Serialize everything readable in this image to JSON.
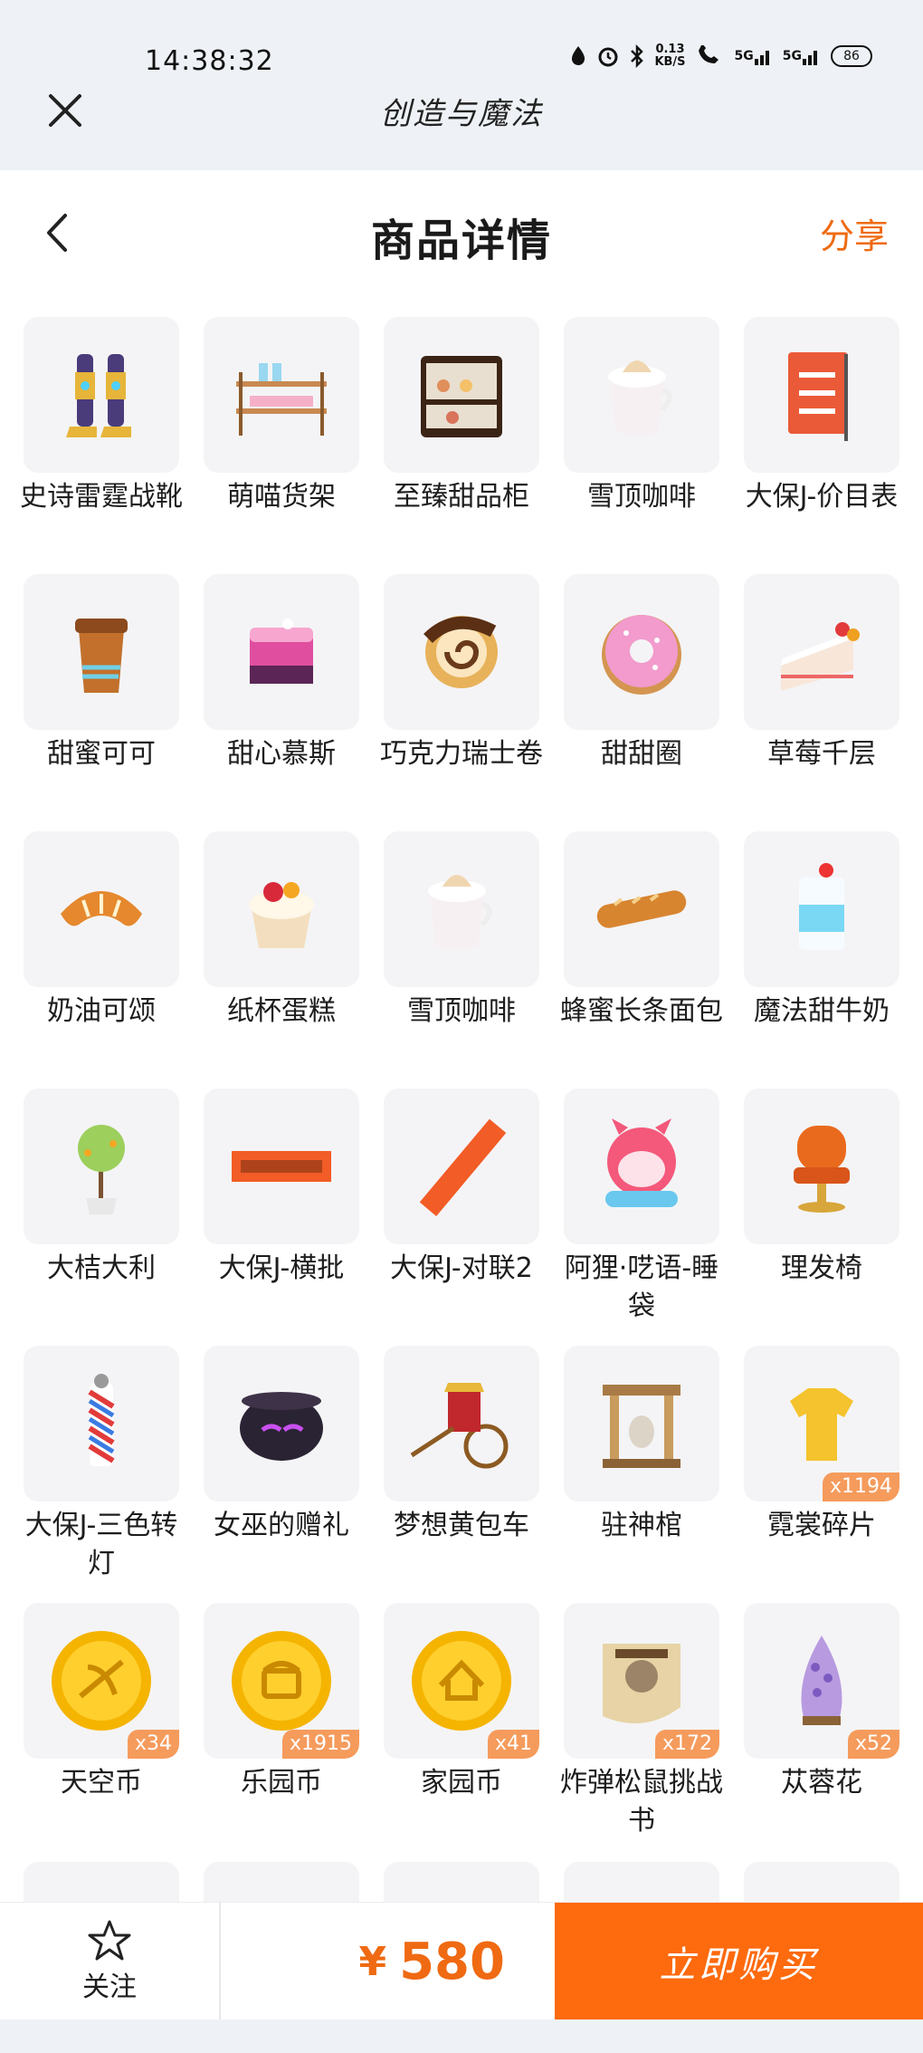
{
  "status": {
    "time": "14:38:32",
    "speed_top": "0.13",
    "speed_unit": "KB/S",
    "sig1": "5G",
    "sig2": "5G",
    "battery": "86"
  },
  "app": {
    "title": "创造与魔法"
  },
  "header": {
    "title": "商品详情",
    "share": "分享"
  },
  "items": [
    {
      "name": "史诗雷霆战靴",
      "icon": "boots-icon",
      "qty": ""
    },
    {
      "name": "萌喵货架",
      "icon": "shelf-icon",
      "qty": ""
    },
    {
      "name": "至臻甜品柜",
      "icon": "dessert-cabinet-icon",
      "qty": ""
    },
    {
      "name": "雪顶咖啡",
      "icon": "coffee-icon",
      "qty": ""
    },
    {
      "name": "大保J-价目表",
      "icon": "price-board-icon",
      "qty": ""
    },
    {
      "name": "甜蜜可可",
      "icon": "cocoa-cup-icon",
      "qty": ""
    },
    {
      "name": "甜心慕斯",
      "icon": "mousse-icon",
      "qty": ""
    },
    {
      "name": "巧克力瑞士卷",
      "icon": "swiss-roll-icon",
      "qty": ""
    },
    {
      "name": "甜甜圈",
      "icon": "donut-icon",
      "qty": ""
    },
    {
      "name": "草莓千层",
      "icon": "cake-slice-icon",
      "qty": ""
    },
    {
      "name": "奶油可颂",
      "icon": "croissant-icon",
      "qty": ""
    },
    {
      "name": "纸杯蛋糕",
      "icon": "cupcake-icon",
      "qty": ""
    },
    {
      "name": "雪顶咖啡",
      "icon": "coffee-icon",
      "qty": ""
    },
    {
      "name": "蜂蜜长条面包",
      "icon": "baguette-icon",
      "qty": ""
    },
    {
      "name": "魔法甜牛奶",
      "icon": "milk-icon",
      "qty": ""
    },
    {
      "name": "大桔大利",
      "icon": "tree-icon",
      "qty": ""
    },
    {
      "name": "大保J-横批",
      "icon": "banner-icon",
      "qty": ""
    },
    {
      "name": "大保J-对联2",
      "icon": "couplet-icon",
      "qty": ""
    },
    {
      "name": "阿狸·呓语-睡袋",
      "icon": "sleeping-bag-icon",
      "qty": ""
    },
    {
      "name": "理发椅",
      "icon": "barber-chair-icon",
      "qty": ""
    },
    {
      "name": "大保J-三色转灯",
      "icon": "barber-pole-icon",
      "qty": ""
    },
    {
      "name": "女巫的赠礼",
      "icon": "cauldron-icon",
      "qty": ""
    },
    {
      "name": "梦想黄包车",
      "icon": "rickshaw-icon",
      "qty": ""
    },
    {
      "name": "驻神棺",
      "icon": "shrine-icon",
      "qty": ""
    },
    {
      "name": "霓裳碎片",
      "icon": "shirt-icon",
      "qty": "x1194"
    },
    {
      "name": "天空币",
      "icon": "sky-coin-icon",
      "qty": "x34"
    },
    {
      "name": "乐园币",
      "icon": "park-coin-icon",
      "qty": "x1915"
    },
    {
      "name": "家园币",
      "icon": "home-coin-icon",
      "qty": "x41"
    },
    {
      "name": "炸弹松鼠挑战书",
      "icon": "wanted-poster-icon",
      "qty": "x172"
    },
    {
      "name": "苁蓉花",
      "icon": "flower-icon",
      "qty": "x52"
    }
  ],
  "bottom": {
    "follow": "关注",
    "currency": "¥",
    "price": "580",
    "buy": "立即购买"
  },
  "colors": {
    "accent": "#fe6a0e",
    "price": "#ef6a12",
    "badge": "#f59b5c"
  }
}
